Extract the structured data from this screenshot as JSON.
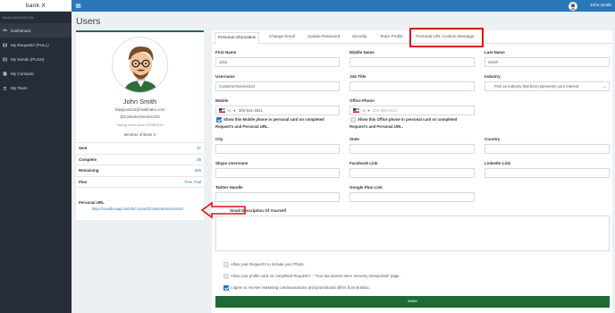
{
  "sidebar": {
    "brand": "bank X",
    "section_label": "MAIN NAVIGATION",
    "items": [
      {
        "label": "Dashboard",
        "icon": "dashboard-icon"
      },
      {
        "label": "My Requests (PULL)",
        "icon": "inbox-icon"
      },
      {
        "label": "My Sends (PUSH)",
        "icon": "send-icon"
      },
      {
        "label": "My Contacts",
        "icon": "contacts-icon"
      },
      {
        "label": "My Team",
        "icon": "team-icon"
      }
    ]
  },
  "topbar": {
    "user_name": "John Smith",
    "accent": "#2b78b8"
  },
  "page": {
    "title": "Users"
  },
  "profile": {
    "name": "John Smith",
    "email": "happyus224@mailinator.com",
    "handle": "@CustomerService224",
    "saving": "Saving trees since 01/08/2018",
    "member": "Member of Bank X",
    "stats": [
      {
        "label": "Sent",
        "value": "37"
      },
      {
        "label": "Complete",
        "value": "39"
      },
      {
        "label": "Remaining",
        "value": "300"
      },
      {
        "label": "Plan",
        "value": "Free Trial"
      }
    ],
    "purl_label": "Personal URL",
    "purl_value": "https://sandboxapp.bobdoc.io/card/CustomerService224"
  },
  "tabs": [
    {
      "label": "Personal Information"
    },
    {
      "label": "Change Email"
    },
    {
      "label": "Update Password"
    },
    {
      "label": "Security"
    },
    {
      "label": "Team Profile"
    },
    {
      "label": "Personal URL Custom Message"
    }
  ],
  "form": {
    "first_name": {
      "label": "First Name",
      "value": "John"
    },
    "middle_name": {
      "label": "Middle Name",
      "value": ""
    },
    "last_name": {
      "label": "Last Name",
      "value": "Smith"
    },
    "username": {
      "label": "Username",
      "value": "CustomerService224"
    },
    "job_title": {
      "label": "Job Title",
      "value": ""
    },
    "industry": {
      "label": "Industry",
      "value": "Pick an industry that best represents your interest"
    },
    "mobile": {
      "label": "Mobile",
      "country_code": "+1",
      "value": "302-941-4921"
    },
    "office_phone": {
      "label": "Office Phone",
      "country_code": "+1",
      "placeholder": "201-555-0123"
    },
    "show_mobile": {
      "line1": "Show this Mobile phone in personal card on completed",
      "line2": "Request's and Personal URL."
    },
    "show_office": {
      "line1": "Allow this Office phone in personal card on completed",
      "line2": "Request's and Personal URL."
    },
    "city": {
      "label": "City",
      "value": ""
    },
    "state": {
      "label": "State",
      "value": ""
    },
    "country": {
      "label": "Country",
      "value": ""
    },
    "skype": {
      "label": "Skype Username",
      "value": ""
    },
    "facebook": {
      "label": "Facebook Link",
      "value": ""
    },
    "linkedin": {
      "label": "LinkedIn Link",
      "value": ""
    },
    "twitter": {
      "label": "Twitter Handle",
      "value": ""
    },
    "google_plus": {
      "label": "Google Plus Link",
      "value": ""
    },
    "description": {
      "label": "Small Description Of Yourself",
      "value": ""
    },
    "options": [
      {
        "label": "Allow your Request's to include your Photo.",
        "checked": false
      },
      {
        "label": "Allow your profile card on completed Request's - \"Your documents were securely transported\" page.",
        "checked": false
      },
      {
        "label": "I agree to receive marketing communications and promotional offers from Bobdoc.",
        "checked": true
      }
    ],
    "save_label": "Save",
    "save_color": "#1f6a34"
  },
  "annotation_color": "#d8151b"
}
